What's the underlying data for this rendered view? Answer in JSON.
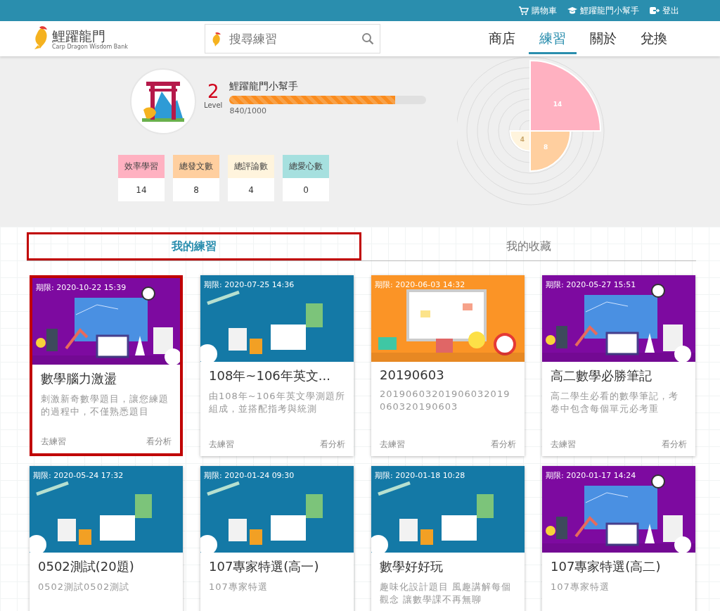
{
  "top_bar": {
    "links": [
      {
        "kind": "cart",
        "label": "購物車"
      },
      {
        "kind": "user",
        "label": "鯉躍龍門小幫手"
      },
      {
        "kind": "logout",
        "label": "登出"
      }
    ]
  },
  "header": {
    "logo": {
      "name": "鯉躍龍門",
      "subtitle": "Carp Dragon Wisdom Bank"
    },
    "search": {
      "placeholder": "搜尋練習"
    },
    "nav": [
      {
        "label": "商店",
        "selected": false
      },
      {
        "label": "練習",
        "selected": true
      },
      {
        "label": "關於",
        "selected": false
      },
      {
        "label": "兌換",
        "selected": false
      }
    ]
  },
  "profile": {
    "level": "2",
    "level_label": "Level",
    "name": "鯉躍龍門小幫手",
    "progress": {
      "level": 0.84,
      "reading": "840/1000"
    },
    "stats": [
      {
        "label": "效率學習",
        "value": "14",
        "color": "#ffb1c1"
      },
      {
        "label": "總發文數",
        "value": "8",
        "color": "#ffcf9f"
      },
      {
        "label": "總評論數",
        "value": "4",
        "color": "#fff4dd"
      },
      {
        "label": "總愛心數",
        "value": "0",
        "color": "#a6e0df"
      }
    ],
    "polar_chart": {
      "segments": [
        {
          "label": "14",
          "color": "#ffb1c1"
        },
        {
          "label": "8",
          "color": "#ffcf9f"
        },
        {
          "label": "4",
          "color": "#fff4dd"
        }
      ]
    }
  },
  "tabs": [
    {
      "label": "我的練習",
      "selected": true,
      "highlighted": true
    },
    {
      "label": "我的收藏",
      "selected": false,
      "highlighted": false
    }
  ],
  "cards": [
    {
      "deadline": "期限: 2020-10-22 15:39",
      "kind": "idea",
      "title": "數學腦力激盪",
      "description": "刺激新奇數學題目，讓您練題的過程中，不僅熟悉題目",
      "actions": [
        "去練習",
        "看分析"
      ],
      "highlighted": true
    },
    {
      "deadline": "期限: 2020-07-25 14:36",
      "kind": "study",
      "title": "108年~106年英文...",
      "description": "由108年~106年英文學測題所組成，並搭配指考與統測",
      "actions": [
        "去練習",
        "看分析"
      ],
      "highlighted": false
    },
    {
      "deadline": "期限: 2020-06-03 14:32",
      "kind": "whiteboard",
      "title": "20190603",
      "description": "20190603201906032019060320190603",
      "actions": [
        "去練習",
        "看分析"
      ],
      "highlighted": false
    },
    {
      "deadline": "期限: 2020-05-27 15:51",
      "kind": "idea",
      "title": "高二數學必勝筆記",
      "description": "高二學生必看的數學筆記，考卷中包含每個單元必考重",
      "actions": [
        "去練習",
        "看分析"
      ],
      "highlighted": false
    },
    {
      "deadline": "期限: 2020-05-24 17:32",
      "kind": "study",
      "title": "0502測試(20題)",
      "description": "0502測試0502測試",
      "highlighted": false
    },
    {
      "deadline": "期限: 2020-01-24 09:30",
      "kind": "study",
      "title": "107專家特選(高一)",
      "description": "107專家特選",
      "highlighted": false
    },
    {
      "deadline": "期限: 2020-01-18 10:28",
      "kind": "study",
      "title": "數學好好玩",
      "description": "趣味化設計題目 風趣講解每個觀念 讓數學課不再無聊",
      "highlighted": false
    },
    {
      "deadline": "期限: 2020-01-17 14:24",
      "kind": "idea",
      "title": "107專家特選(高二)",
      "description": "107專家特選",
      "highlighted": false
    }
  ]
}
